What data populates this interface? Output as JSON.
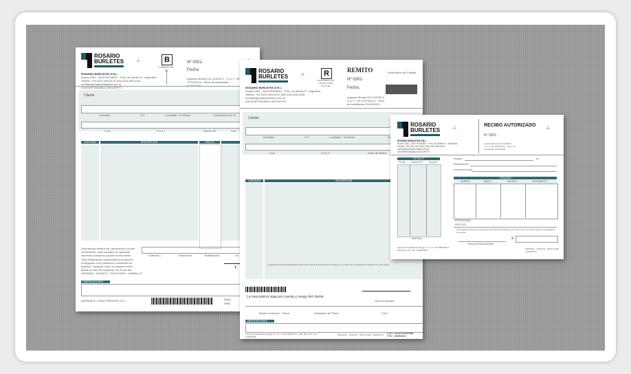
{
  "company": {
    "name_line1": "ROSARIO",
    "name_line2": "BURLETES",
    "legal_name": "ROSARIO BURLETES S.R.L.",
    "address": "Rosas 1553 · 2000 ROSARIO · Prov. de Santa Fe · Argentina",
    "phone": "Teléfax: +54 (341) 464-8122 465-4223 465-4226",
    "email": "burletes@rosarioburletes.com.ar",
    "iva": "IVA RESPONSABLE INSCRIPTO"
  },
  "factura": {
    "letter": "B",
    "letter_caption": "CODIGO Nº 06",
    "number": "Nº 0001-",
    "date_label": "Fecha:",
    "tax_info": "Ingresos Brutos 021-113293-3 · C.U.I.T. 30-70737644-4 · Inicio de Actividades 01/10/2000",
    "fields": {
      "client": "Cliente",
      "domicilio": "Domicilio",
      "cp": "C.P.",
      "localidad": "Localidad - Provincia",
      "condiciones": "Condiciones de Ve",
      "iva": "I.V.A.",
      "cuit": "C.U.I.T",
      "remito": "Remito Nº",
      "cod": "Cod."
    },
    "columns": [
      "CANTIDAD",
      "DESCRIPCION",
      "PRECIO"
    ],
    "totals": [
      "Subtotal 1",
      "Descuento",
      "Bonificación",
      "Su"
    ],
    "total_label": "T",
    "notes1": "Esta factura deberá ser cancelada el día del vencimiento; caso contrario se aplicarán intereses punitorios a partir de esa fecha.",
    "notes2": "Toda reclamación efectuada por productos entregados o los vendidos o exhibición de Burletes, contarán como se sostiene entre desde el valor de la factura, de no ser así",
    "copies": "ORIGINAL : BLANCO · DUPLICADO : AMARILLO",
    "obs": "OBSERVACIONES",
    "printer": "IMPRENTA: GUIDO PRINTER S.R.L.",
    "cai": "C.A.I.",
    "vto": "VTO."
  },
  "remito": {
    "title": "REMITO",
    "letter": "R",
    "letter_caption": "DOCUMENTO NO VALIDO COMO FACTURA",
    "number": "Nº 0001-",
    "date_label": "Fecha:",
    "cert": "Certificación de Calidad",
    "tax_info": "Ingresos Brutos 021-113293-3 · C.U.I.T. 30-70737644-4 · Inicio de Actividades 01/10/2000",
    "fields": {
      "client": "Cliente",
      "domicilio": "Domicilio",
      "cp": "C.P.",
      "localidad": "Localidad - Provincia",
      "transporte": "Transport",
      "iva": "I.V.A.",
      "cuit": "C.U.I.T",
      "cant_bultos": "Cant. de Bultos"
    },
    "columns": [
      "CANTIDAD",
      "DESCRIPCION"
    ],
    "notes": "La devolución deberá efectuarse dentro de los 30 días de la fecha de emisión, en el caso de no recepción mercancía con este remito.",
    "travel_note": "La mercadería viaja por cuenta y riesgo del cliente.",
    "valor": "Valor Declarado",
    "signatures": [
      "Recibí Conforme - Firma",
      "Aclaración de Firma",
      "D.N.I."
    ],
    "obs": "OBSERVACIONES",
    "printer": "Imprenta: Rivadavia de Megg S.·C.U.I.T. 30-70878190-3 · Hab. Mun. Exp. Nro. 16464/2000",
    "copies": "ORIGINAL : BLANCO · DUPLICADO : AMARILLO",
    "cai": "C.A.I.: 21047121510888",
    "vto": "VTO.: 16/05/2013"
  },
  "recibo": {
    "title": "RECIBO AUTORIZADO",
    "number": "Nº 0001 -",
    "tax_info": "Ingresos Brutos 021-113293-3 · C.U.I.T. 30-70737644-4 · Inicio de Actividades 01/10/2000",
    "place": "Rosario,",
    "de": "de",
    "recibimos": "Recibimos de",
    "suma": "la suma de pesos",
    "detalle": "DETALLE",
    "detalle_cols": [
      "Fecha",
      "Factura Nº",
      "Importe"
    ],
    "cheques": "CHEQUES",
    "cheques_cols": [
      "NUMERO",
      "BANCO",
      "IMPORTE",
      "VENCIMIENTO"
    ],
    "retenciones": "RETENCIONES",
    "efectivo": "EFECTIVO",
    "total": "Total Neto",
    "firma": "Firma por Rosario Burletes",
    "currency": "$",
    "condition": "Los valores descriptos se acelan al solo efecto de gestionar su cobro y son sin efectos hasta su acreditación en cuenta.",
    "copies": "ORIGINAL : BLANCO · DUPLICADO : AMARILLO"
  }
}
